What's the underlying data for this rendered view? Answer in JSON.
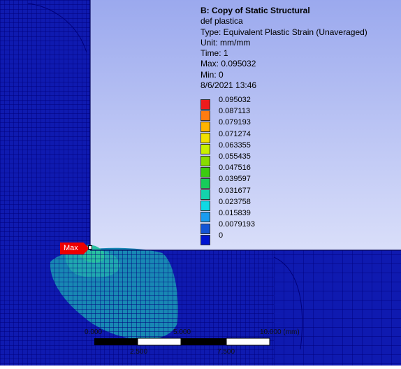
{
  "result": {
    "title": "B: Copy of Static Structural",
    "name": "def plastica",
    "type": "Type: Equivalent Plastic Strain (Unaveraged)",
    "unit": "Unit: mm/mm",
    "time": "Time: 1",
    "max": "Max: 0.095032",
    "min": "Min: 0",
    "date": "8/6/2021 13:46"
  },
  "legend": {
    "levels": [
      {
        "label": "0.095032",
        "color": "#ee1c1c"
      },
      {
        "label": "0.087113",
        "color": "#ff7c10"
      },
      {
        "label": "0.079193",
        "color": "#ffb400"
      },
      {
        "label": "0.071274",
        "color": "#f2e000"
      },
      {
        "label": "0.063355",
        "color": "#c8f000"
      },
      {
        "label": "0.055435",
        "color": "#88dc00"
      },
      {
        "label": "0.047516",
        "color": "#3ccc10"
      },
      {
        "label": "0.039597",
        "color": "#18cc5a"
      },
      {
        "label": "0.031677",
        "color": "#14d2ac"
      },
      {
        "label": "0.023758",
        "color": "#10d8e4"
      },
      {
        "label": "0.015839",
        "color": "#1a9cf0"
      },
      {
        "label": "0.0079193",
        "color": "#1454d6"
      },
      {
        "label": "0",
        "color": "#0014d0"
      }
    ]
  },
  "probe": {
    "max_label": "Max"
  },
  "scale": {
    "labels": [
      "0.000",
      "5.000",
      "10.000 (mm)",
      "2.500",
      "7.500"
    ]
  },
  "colors": {
    "background_top": "#9ba9ee",
    "background_bottom": "#f6f7ff",
    "mesh_fill": "#0f1ab0",
    "mesh_line": "#00008a"
  }
}
